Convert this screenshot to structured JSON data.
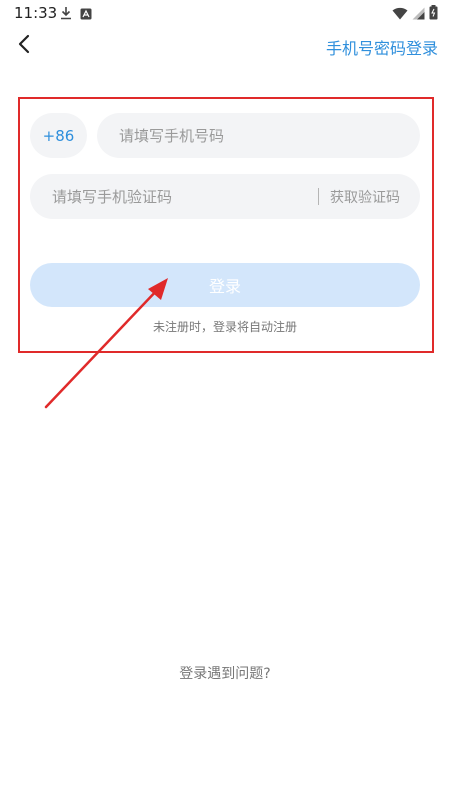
{
  "status_bar": {
    "time": "11:33",
    "icons_left": [
      "download-icon",
      "app-notification-icon"
    ],
    "icons_right": [
      "wifi-icon",
      "signal-icon",
      "battery-icon"
    ]
  },
  "header": {
    "back_icon": "chevron-left-icon",
    "switch_login_label": "手机号密码登录"
  },
  "form": {
    "country_code": "+86",
    "phone_placeholder": "请填写手机号码",
    "phone_value": "",
    "code_placeholder": "请填写手机验证码",
    "code_value": "",
    "get_code_label": "获取验证码",
    "login_button_label": "登录",
    "auto_register_note": "未注册时，登录将自动注册"
  },
  "footer": {
    "help_label": "登录遇到问题?"
  },
  "colors": {
    "accent": "#2f8fdc",
    "login_button_disabled": "#d3e6fb",
    "annotation": "#e02a2a",
    "input_background": "#f3f4f6"
  }
}
